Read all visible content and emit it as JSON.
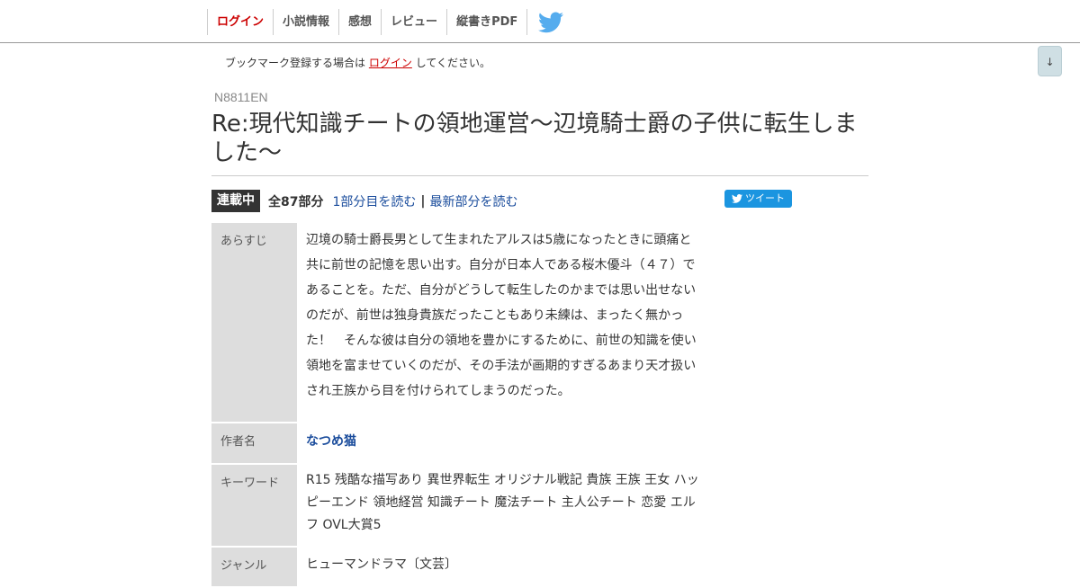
{
  "nav": {
    "items": [
      "ログイン",
      "小説情報",
      "感想",
      "レビュー",
      "縦書きPDF"
    ],
    "twitter_icon": "twitter-bird-icon",
    "twitter_color": "#55acee"
  },
  "scroll_button": "↓",
  "bookmark": {
    "prefix": "ブックマーク登録する場合は",
    "login_link": "ログイン",
    "suffix": "してください。"
  },
  "novel": {
    "ncode": "N8811EN",
    "title": "Re:現代知識チートの領地運営～辺境騎士爵の子供に転生しました～",
    "status_badge": "連載中",
    "total_parts": "全87部分",
    "read_first": "1部分目を読む",
    "separator": "|",
    "read_latest": "最新部分を読む",
    "tweet_label": "ツイート"
  },
  "info": {
    "summary_label": "あらすじ",
    "summary": "辺境の騎士爵長男として生まれたアルスは5歳になったときに頭痛と共に前世の記憶を思い出す。自分が日本人である桜木優斗（４７）であることを。ただ、自分がどうして転生したのかまでは思い出せないのだが、前世は独身貴族だったこともあり未練は、まったく無かった！　そんな彼は自分の領地を豊かにするために、前世の知識を使い領地を富ませていくのだが、その手法が画期的すぎるあまり天才扱いされ王族から目を付けられてしまうのだった。",
    "author_label": "作者名",
    "author": "なつめ猫",
    "keyword_label": "キーワード",
    "keywords": "R15 残酷な描写あり 異世界転生  オリジナル戦記 貴族 王族 王女 ハッピーエンド 領地経営 知識チート 魔法チート 主人公チート 恋愛 エルフ OVL大賞5",
    "genre_label": "ジャンル",
    "genre": "ヒューマンドラマ〔文芸〕"
  },
  "colors": {
    "login_red": "#cc0000",
    "link_blue": "#1a4c9c",
    "badge_bg": "#333333",
    "tweet_blue": "#1b95e0",
    "table_header_bg": "#dddddd"
  }
}
